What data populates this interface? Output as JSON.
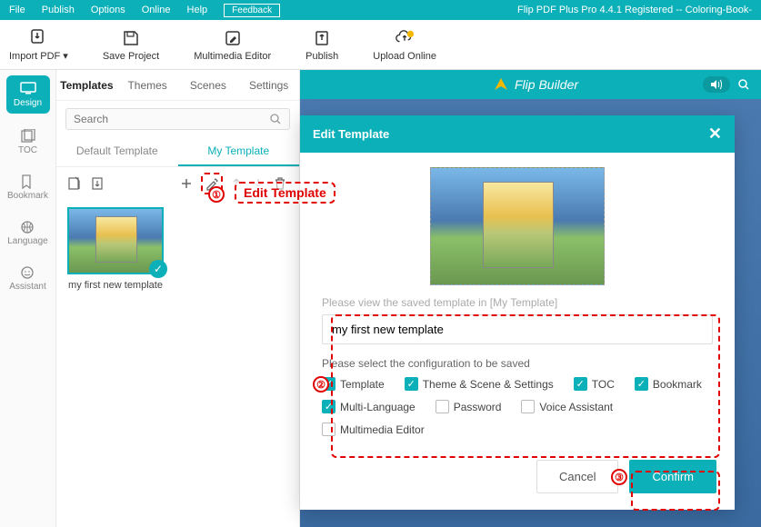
{
  "menubar": {
    "items": [
      "File",
      "Publish",
      "Options",
      "Online",
      "Help"
    ],
    "feedback": "Feedback",
    "title": "Flip PDF Plus Pro 4.4.1 Registered -- Coloring-Book-"
  },
  "toolbar": {
    "import": "Import PDF ▾",
    "save": "Save Project",
    "multimedia": "Multimedia Editor",
    "publish": "Publish",
    "upload": "Upload Online"
  },
  "sidebar": {
    "items": [
      {
        "label": "Design"
      },
      {
        "label": "TOC"
      },
      {
        "label": "Bookmark"
      },
      {
        "label": "Language"
      },
      {
        "label": "Assistant"
      }
    ]
  },
  "panel": {
    "tabs": [
      "Templates",
      "Themes",
      "Scenes",
      "Settings"
    ],
    "search_placeholder": "Search",
    "subtabs": [
      "Default Template",
      "My Template"
    ],
    "thumb_label": "my first new template"
  },
  "preview": {
    "brand": "Flip Builder"
  },
  "modal": {
    "title": "Edit Template",
    "hint": "Please view the saved template in [My Template]",
    "input_value": "my first new template",
    "conf_label": "Please select the configuration to be saved",
    "checks": [
      {
        "label": "Template",
        "checked": true
      },
      {
        "label": "Theme & Scene & Settings",
        "checked": true
      },
      {
        "label": "TOC",
        "checked": true
      },
      {
        "label": "Bookmark",
        "checked": true
      },
      {
        "label": "Multi-Language",
        "checked": true
      },
      {
        "label": "Password",
        "checked": false
      },
      {
        "label": "Voice Assistant",
        "checked": false
      },
      {
        "label": "Multimedia Editor",
        "checked": false
      }
    ],
    "cancel": "Cancel",
    "confirm": "Confirm"
  },
  "annotations": {
    "edit_template": "Edit Template"
  }
}
